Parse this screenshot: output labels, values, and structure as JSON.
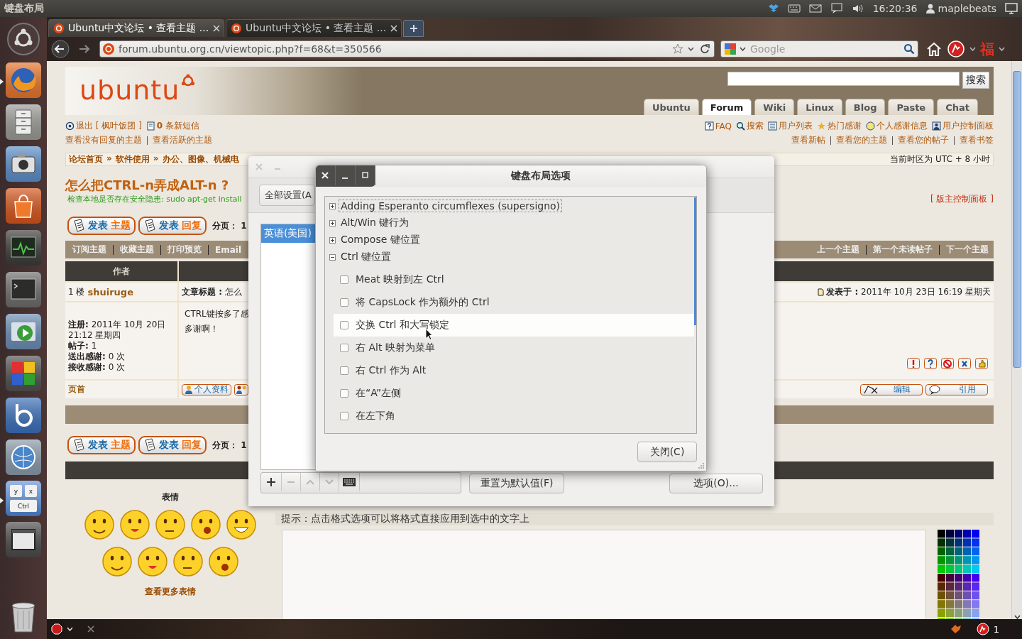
{
  "top_panel": {
    "title": "键盘布局",
    "clock": "16:20:36",
    "user": "maplebeats"
  },
  "launcher": {
    "keyboard_keys": [
      "y",
      "x",
      "Ctrl"
    ]
  },
  "browser": {
    "tabs": [
      {
        "title": "Ubuntu中文论坛 • 查看主题 ...",
        "selected": true
      },
      {
        "title": "Ubuntu中文论坛 • 查看主题 ...",
        "selected": false
      }
    ],
    "url": "forum.ubuntu.org.cn/viewtopic.php?f=68&t=350566",
    "search_placeholder": "Google",
    "extension_glyph": "福"
  },
  "forum": {
    "logo": "ubuntu",
    "search_button": "搜索",
    "nav_tabs": [
      {
        "label": "Ubuntu",
        "selected": false
      },
      {
        "label": "Forum",
        "selected": true
      },
      {
        "label": "Wiki",
        "selected": false
      },
      {
        "label": "Linux",
        "selected": false
      },
      {
        "label": "Blog",
        "selected": false
      },
      {
        "label": "Paste",
        "selected": false
      },
      {
        "label": "Chat",
        "selected": false
      }
    ],
    "user_links": [
      "退出 [ 枫叶饭团 ]",
      "**0** 条新短信"
    ],
    "tool_links": [
      "FAQ",
      "搜索",
      "用户列表",
      "热门感谢",
      "个人感谢信息",
      "用户控制面板"
    ],
    "topic_links": [
      "查看没有回复的主题",
      "查看活跃的主题"
    ],
    "my_links": [
      "查看新帖",
      "查看您的主题",
      "查看您的帖子",
      "查看书签"
    ],
    "breadcrumb": {
      "items": [
        "论坛首页",
        "软件使用",
        "办公、图像、机械电"
      ],
      "separator": "»"
    },
    "timezone": "当前时区为 UTC + 8 小时",
    "topic_title": "怎么把CTRL-n弄成ALT-n ?",
    "notice": "检查本地是否存在安全隐患: sudo apt-get install",
    "moderator_link": "[ 版主控制面板 ]",
    "post_buttons": [
      {
        "verb": "发表",
        "object": "主题"
      },
      {
        "verb": "发表",
        "object": "回复"
      }
    ],
    "pagination": "分页： 1",
    "topic_actions": [
      "订阅主题",
      "收藏主题",
      "打印预览",
      "Email"
    ],
    "topic_nav": [
      "上一个主题",
      "第一个未读帖子",
      "下一个主题"
    ],
    "author_header": "作者",
    "post": {
      "floor": "1 楼",
      "author": "shuiruge",
      "subject": "**文章标题 :** 怎么",
      "posted": "**发表于 :** 2011年 10月 23日 16:19 星期天",
      "profile": [
        "**注册:** 2011年 10月 20日 21:12 星期四",
        "**帖子:** 1",
        "**送出感谢:** 0 次",
        "**接收感谢:** 0 次"
      ],
      "body_lines": [
        "CTRL键按多了感",
        "多谢啊！"
      ],
      "top_link": "页首",
      "profile_button": "个人资料",
      "edit_button": "编辑",
      "quote_button": "引用"
    },
    "post_buttons_bottom": [
      {
        "verb": "发表",
        "object": "主题"
      },
      {
        "verb": "发表",
        "object": "回复"
      }
    ],
    "pagination_bottom": "分页： 1",
    "emoticons": {
      "title": "表情",
      "more_link": "查看更多表情"
    },
    "editor": {
      "hint": "提示：点击格式选项可以将格式直接应用到选中的文字上"
    }
  },
  "layout_window": {
    "all_settings_tab": "全部设置(A",
    "layouts": [
      {
        "label": "英语(美国)",
        "selected": true
      }
    ],
    "reset_button": "重置为默认值(F)",
    "options_button": "选项(O)..."
  },
  "options_dialog": {
    "title": "键盘布局选项",
    "groups": [
      {
        "label": "Adding Esperanto circumflexes (supersigno)",
        "expanded": false,
        "focused": true
      },
      {
        "label": "Alt/Win 键行为",
        "expanded": false,
        "focused": false
      },
      {
        "label": "Compose 键位置",
        "expanded": false,
        "focused": false
      },
      {
        "label": "Ctrl 键位置",
        "expanded": true,
        "focused": false,
        "options": [
          {
            "label": "Meat 映射到左 Ctrl",
            "checked": false,
            "highlighted": false
          },
          {
            "label": "将 CapsLock 作为额外的 Ctrl",
            "checked": false,
            "highlighted": false
          },
          {
            "label": "交换 Ctrl 和大写锁定",
            "checked": false,
            "highlighted": true
          },
          {
            "label": "右 Alt 映射为菜单",
            "checked": false,
            "highlighted": false
          },
          {
            "label": "右 Ctrl 作为 Alt",
            "checked": false,
            "highlighted": false
          },
          {
            "label": "在“A”左侧",
            "checked": false,
            "highlighted": false
          },
          {
            "label": "在左下角",
            "checked": false,
            "highlighted": false
          }
        ]
      }
    ],
    "close_button": "关闭(C)"
  },
  "status_bar": {
    "count": "1"
  }
}
